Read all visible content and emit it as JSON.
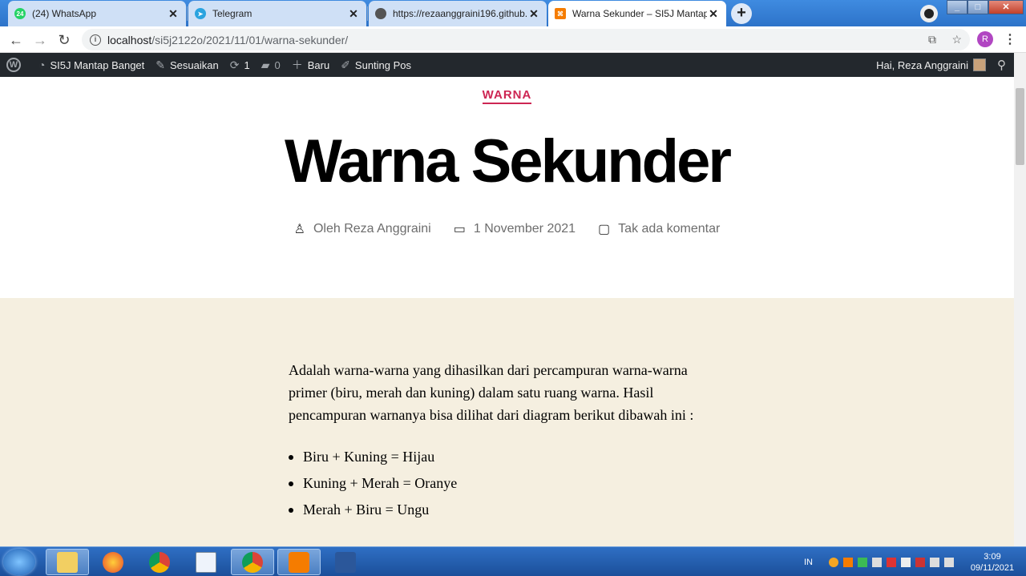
{
  "browser": {
    "tabs": [
      {
        "title": "(24) WhatsApp",
        "badge": "24",
        "active": false
      },
      {
        "title": "Telegram",
        "active": false
      },
      {
        "title": "https://rezaanggraini196.github.i",
        "active": false
      },
      {
        "title": "Warna Sekunder – SI5J Mantap B",
        "active": true
      }
    ],
    "url_host": "localhost",
    "url_path": "/si5j2122o/2021/11/01/warna-sekunder/"
  },
  "adminbar": {
    "site_name": "SI5J Mantap Banget",
    "customize": "Sesuaikan",
    "updates_count": "1",
    "comments_count": "0",
    "new_label": "Baru",
    "edit_post": "Sunting Pos",
    "greeting": "Hai, Reza Anggraini"
  },
  "post": {
    "category": "WARNA",
    "title": "Warna Sekunder",
    "author": "Oleh Reza Anggraini",
    "date": "1 November 2021",
    "comments": "Tak ada komentar",
    "paragraph": "Adalah warna-warna yang dihasilkan dari percampuran warna-warna primer (biru, merah dan kuning) dalam satu ruang warna. Hasil pencampuran warnanya bisa dilihat dari diagram berikut dibawah ini :",
    "list": [
      "Biru + Kuning = Hijau",
      "Kuning + Merah = Oranye",
      "Merah + Biru = Ungu"
    ]
  },
  "taskbar": {
    "lang": "IN",
    "time": "3:09",
    "date": "09/11/2021"
  },
  "colors": {
    "accent": "#cd2653",
    "content_bg": "#f5efe0",
    "adminbar": "#23282d"
  }
}
